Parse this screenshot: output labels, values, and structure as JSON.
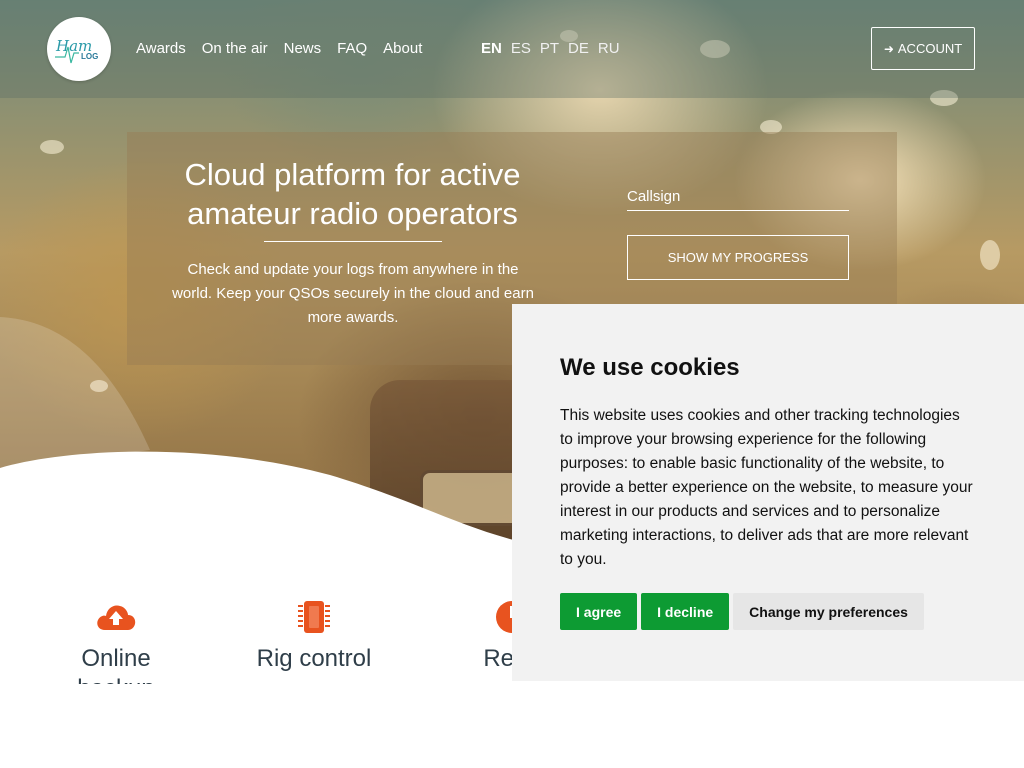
{
  "nav": {
    "items": [
      {
        "label": "Awards"
      },
      {
        "label": "On the air"
      },
      {
        "label": "News"
      },
      {
        "label": "FAQ"
      },
      {
        "label": "About"
      }
    ],
    "languages": [
      {
        "code": "EN",
        "active": true
      },
      {
        "code": "ES",
        "active": false
      },
      {
        "code": "PT",
        "active": false
      },
      {
        "code": "DE",
        "active": false
      },
      {
        "code": "RU",
        "active": false
      }
    ],
    "account_label": "ACCOUNT",
    "logo_text": "Ham LOG"
  },
  "hero": {
    "title": "Cloud platform for active amateur radio operators",
    "subtitle": "Check and update your logs from anywhere in the world. Keep your QSOs securely in the cloud and earn more awards.",
    "callsign_placeholder": "Callsign",
    "progress_button": "SHOW MY PROGRESS"
  },
  "features": [
    {
      "label": "Online",
      "label2": "backup",
      "icon": "cloud-upload-icon"
    },
    {
      "label": "Rig control",
      "label2": "",
      "icon": "chip-icon"
    },
    {
      "label": "Real-",
      "label2": "",
      "icon": "clock-icon"
    }
  ],
  "cookie": {
    "title": "We use cookies",
    "text": "This website uses cookies and other tracking technologies to improve your browsing experience for the following purposes: to enable basic functionality of the website, to provide a better experience on the website, to measure your interest in our products and services and to personalize marketing interactions, to deliver ads that are more relevant to you.",
    "agree": "I agree",
    "decline": "I decline",
    "preferences": "Change my preferences"
  },
  "colors": {
    "accent_orange": "#e8531f",
    "cookie_green": "#0d9b33",
    "feature_text": "#2f3e49"
  }
}
